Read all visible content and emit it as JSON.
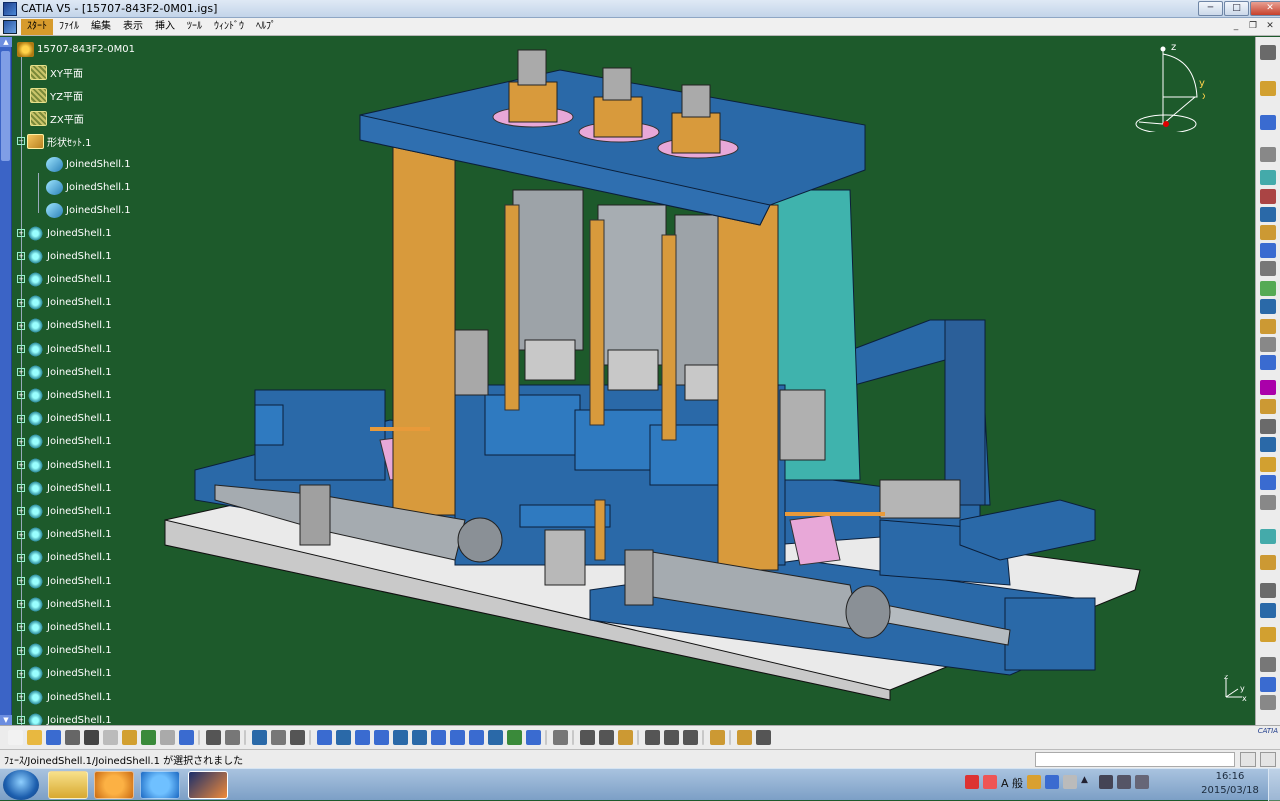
{
  "window": {
    "title": "CATIA V5 - [15707-843F2-0M01.igs]",
    "controls": [
      "─",
      "□",
      "✕"
    ]
  },
  "menu": {
    "items": [
      {
        "label": "ｽﾀｰﾄ",
        "active": true
      },
      {
        "label": "ﾌｧｲﾙ"
      },
      {
        "label": "編集"
      },
      {
        "label": "表示"
      },
      {
        "label": "挿入"
      },
      {
        "label": "ﾂｰﾙ"
      },
      {
        "label": "ｳｨﾝﾄﾞｳ"
      },
      {
        "label": "ﾍﾙﾌﾟ"
      }
    ],
    "doc_controls": [
      "_",
      "❐",
      "✕"
    ]
  },
  "tree": {
    "root": "15707-843F2-0M01",
    "planes": [
      "XY平面",
      "YZ平面",
      "ZX平面"
    ],
    "geom_set": {
      "label": "形状ｾｯﾄ.1",
      "children": [
        "JoinedShell.1",
        "JoinedShell.1",
        "JoinedShell.1"
      ]
    },
    "shells": [
      "JoinedShell.1",
      "JoinedShell.1",
      "JoinedShell.1",
      "JoinedShell.1",
      "JoinedShell.1",
      "JoinedShell.1",
      "JoinedShell.1",
      "JoinedShell.1",
      "JoinedShell.1",
      "JoinedShell.1",
      "JoinedShell.1",
      "JoinedShell.1",
      "JoinedShell.1",
      "JoinedShell.1",
      "JoinedShell.1",
      "JoinedShell.1",
      "JoinedShell.1",
      "JoinedShell.1",
      "JoinedShell.1",
      "JoinedShell.1",
      "JoinedShell.1",
      "JoinedShell.1"
    ]
  },
  "compass": {
    "x_label": "x",
    "y_label": "y",
    "z_label": "z"
  },
  "axis_corner": {
    "x_label": "x",
    "y_label": "y",
    "z_label": "z"
  },
  "brand": "CATIA",
  "status": {
    "message": "ﾌｪｰｽ/JoinedShell.1/JoinedShell.1 が選択されました"
  },
  "taskbar": {
    "ime": "A 般",
    "time": "16:16",
    "date": "2015/03/18"
  },
  "colors": {
    "background": "#1d5a2b",
    "frame_blue": "#2a69a8",
    "column_tan": "#d89a3c",
    "cylinder_gray": "#9da3a8",
    "pad_pink": "#e8a8d8",
    "base_white": "#e8e8e8",
    "teal": "#3fb3ad"
  }
}
